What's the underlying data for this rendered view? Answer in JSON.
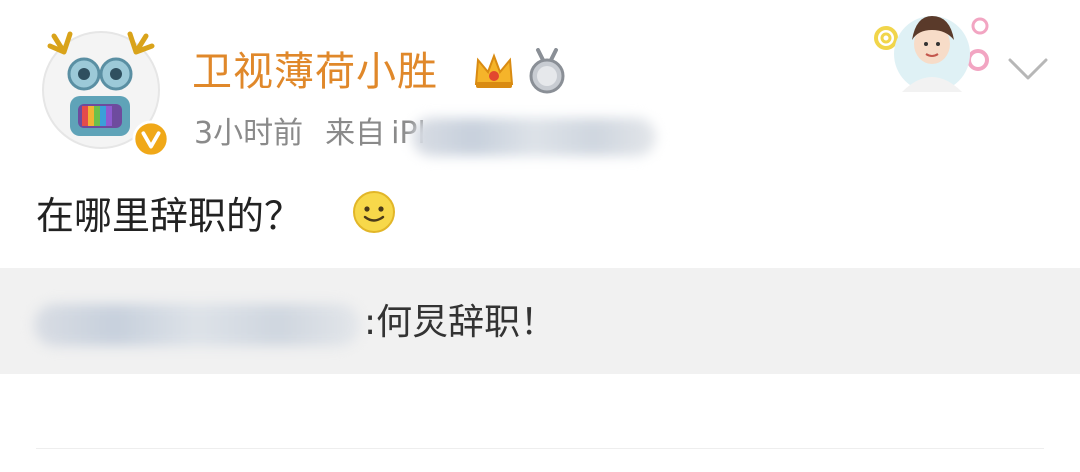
{
  "post": {
    "author_name": "卫视薄荷小胜",
    "time": "3小时前",
    "source_prefix": "来自",
    "source_visible": "iPl",
    "text": "在哪里辞职的？",
    "emoji": "smile-emoji",
    "quote_suffix": ":何炅辞职！"
  },
  "icons": {
    "crown": "crown-badge-icon",
    "medal": "medal-badge-icon",
    "verified": "verified-v-icon",
    "chevron": "chevron-down-icon"
  },
  "colors": {
    "name": "#e0882a",
    "meta": "#8a8a8a",
    "text": "#222222",
    "quote_bg": "#f1f1f1",
    "verified": "#f0a818"
  }
}
